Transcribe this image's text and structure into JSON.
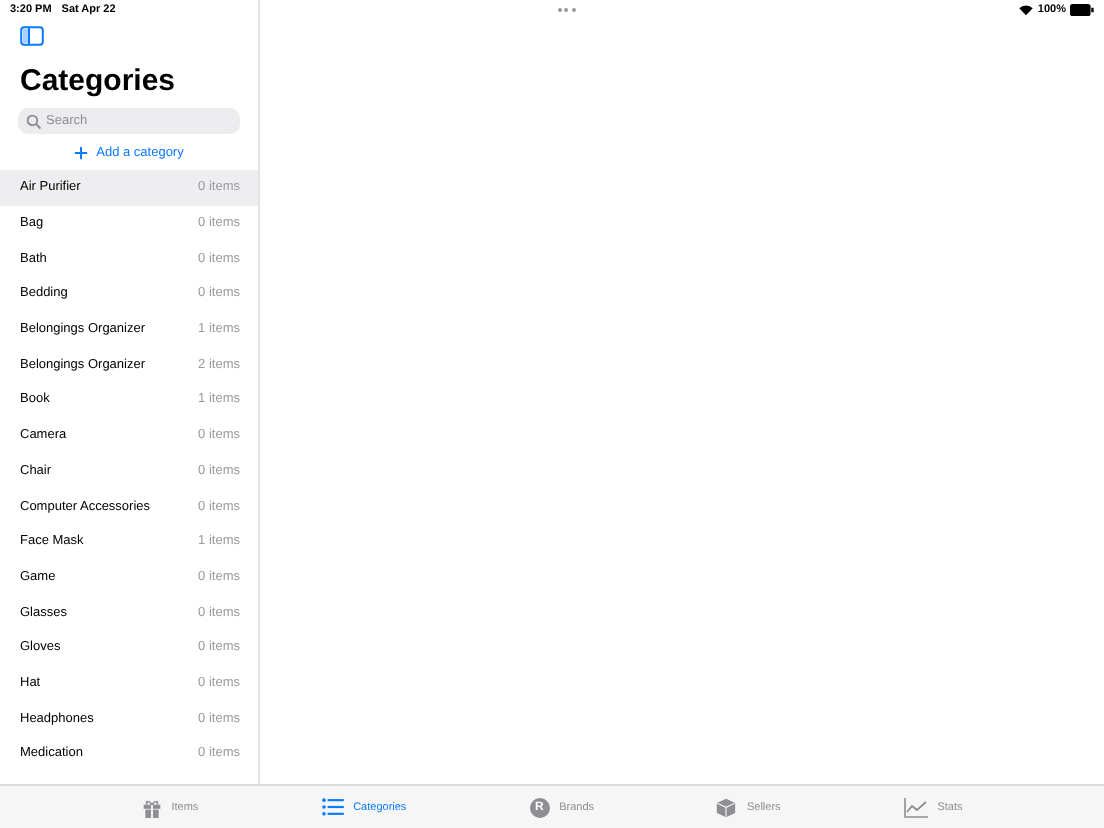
{
  "status_bar": {
    "time": "3:20 PM",
    "date": "Sat Apr 22",
    "battery": "100%"
  },
  "sidebar": {
    "title": "Categories",
    "search": {
      "placeholder": "Search"
    },
    "add_button": "Add a category",
    "items": [
      {
        "name": "Air Purifier",
        "count": "0 items",
        "selected": true
      },
      {
        "name": "Bag",
        "count": "0 items",
        "selected": false
      },
      {
        "name": "Bath",
        "count": "0 items",
        "selected": false
      },
      {
        "name": "Bedding",
        "count": "0 items",
        "selected": false
      },
      {
        "name": "Belongings Organizer",
        "count": "1 items",
        "selected": false
      },
      {
        "name": "Belongings Organizer",
        "count": "2 items",
        "selected": false
      },
      {
        "name": "Book",
        "count": "1 items",
        "selected": false
      },
      {
        "name": "Camera",
        "count": "0 items",
        "selected": false
      },
      {
        "name": "Chair",
        "count": "0 items",
        "selected": false
      },
      {
        "name": "Computer Accessories",
        "count": "0 items",
        "selected": false
      },
      {
        "name": "Face Mask",
        "count": "1 items",
        "selected": false
      },
      {
        "name": "Game",
        "count": "0 items",
        "selected": false
      },
      {
        "name": "Glasses",
        "count": "0 items",
        "selected": false
      },
      {
        "name": "Gloves",
        "count": "0 items",
        "selected": false
      },
      {
        "name": "Hat",
        "count": "0 items",
        "selected": false
      },
      {
        "name": "Headphones",
        "count": "0 items",
        "selected": false
      },
      {
        "name": "Medication",
        "count": "0 items",
        "selected": false
      }
    ]
  },
  "tab_bar": [
    {
      "kind": "gift",
      "label": "Items",
      "selected": false
    },
    {
      "kind": "list",
      "label": "Categories",
      "selected": true
    },
    {
      "kind": "brand",
      "label": "Brands",
      "selected": false,
      "glyph": "R"
    },
    {
      "kind": "box",
      "label": "Sellers",
      "selected": false
    },
    {
      "kind": "chart",
      "label": "Stats",
      "selected": false
    }
  ]
}
